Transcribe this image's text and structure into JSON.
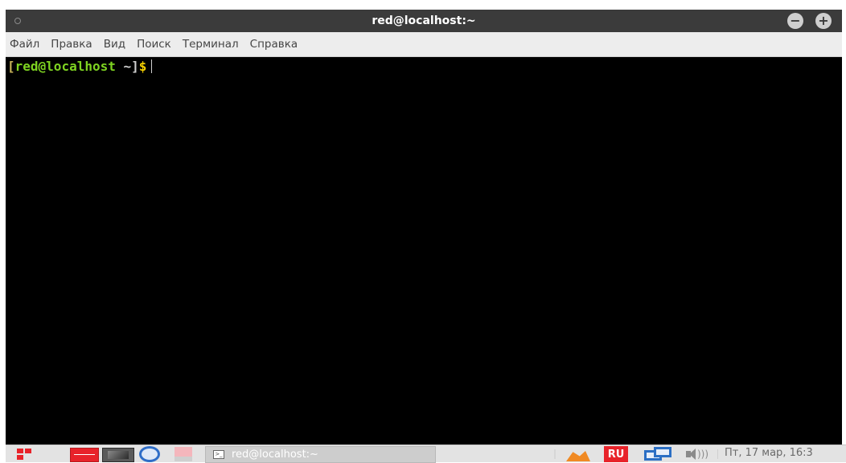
{
  "window": {
    "title": "red@localhost:~",
    "titlebar_color": "#3b3b3b",
    "buttons": [
      "minimize-icon",
      "maximize-icon"
    ]
  },
  "menubar": {
    "items": [
      "Файл",
      "Правка",
      "Вид",
      "Поиск",
      "Терминал",
      "Справка"
    ]
  },
  "terminal": {
    "prompt": {
      "open_bracket": "[",
      "user_host": "red@localhost",
      "path": " ~]",
      "symbol": "$"
    },
    "background": "#000000",
    "prompt_color": "#7ed321",
    "symbol_color": "#f5d000"
  },
  "taskbar": {
    "launchers": [
      "menu-icon",
      "red-app-icon",
      "terminal-app-icon",
      "search-icon",
      "pink-app-icon"
    ],
    "task": {
      "label": "red@localhost:~"
    },
    "language": "RU",
    "tray_icons": [
      "orange-app-icon",
      "network-icon",
      "volume-icon"
    ],
    "clock": "Пт, 17 мар, 16:3"
  }
}
